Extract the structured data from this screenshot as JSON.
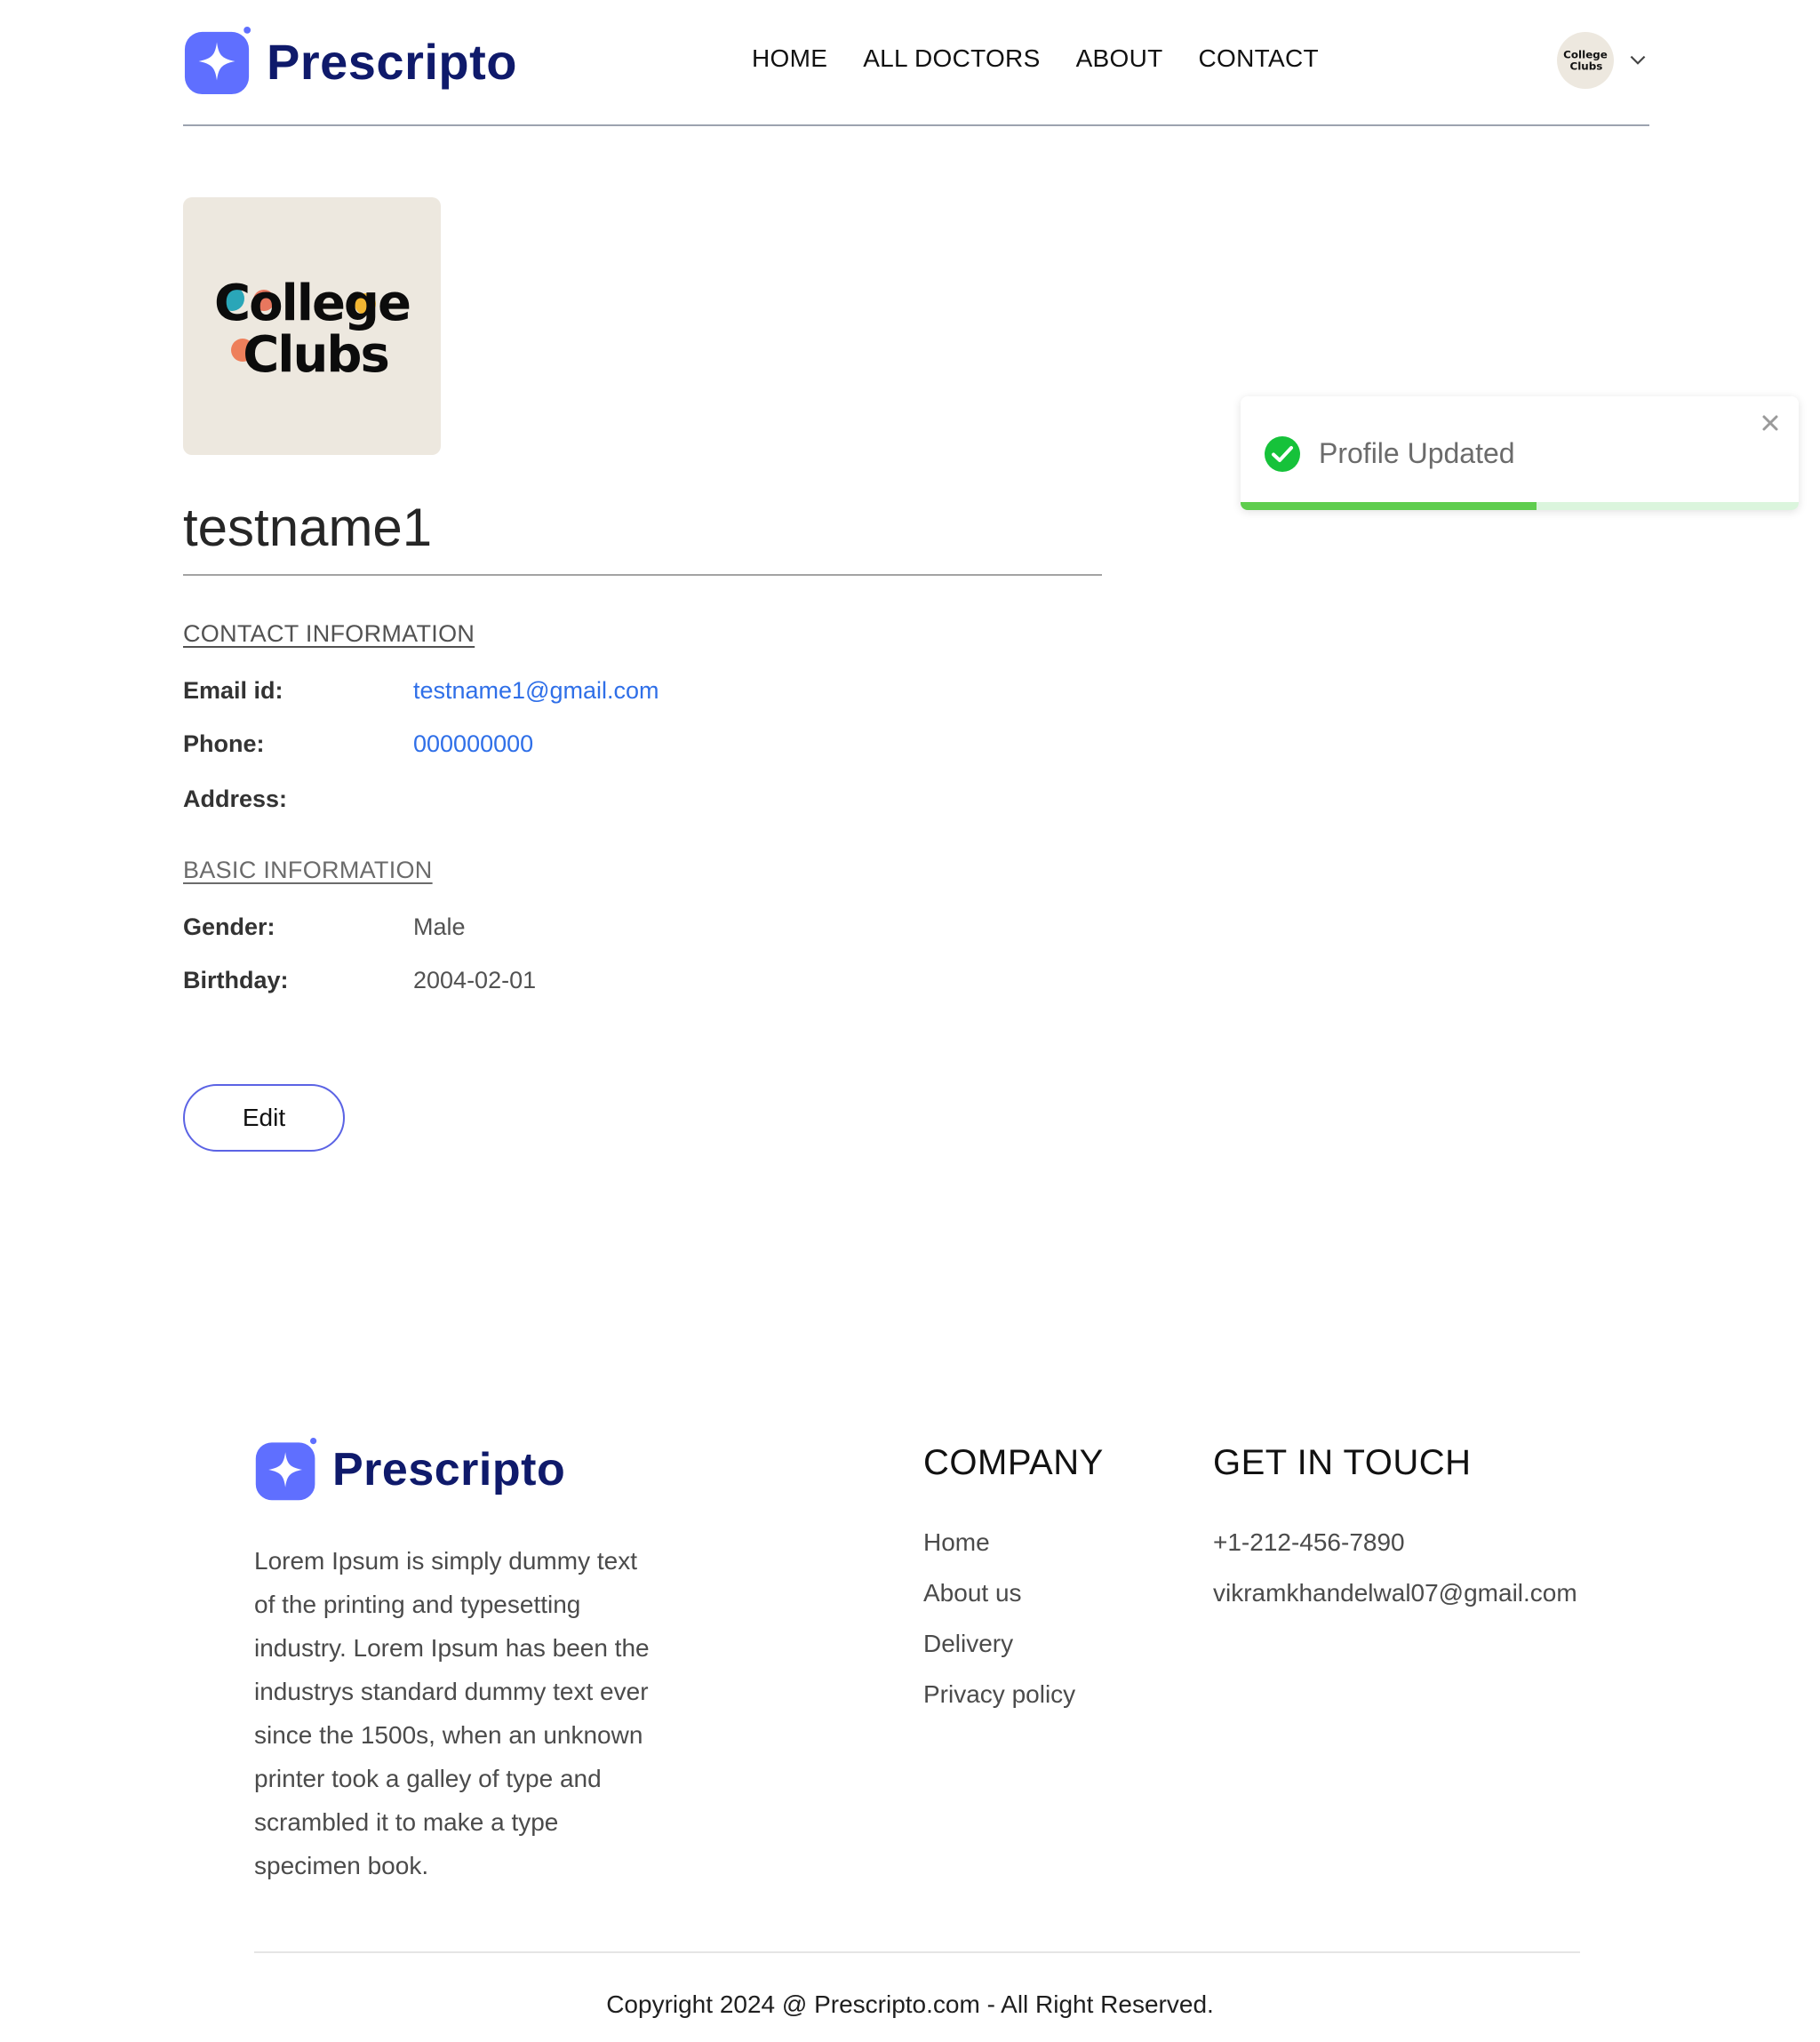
{
  "brand": {
    "name": "Prescripto",
    "color": "#0f1a6b",
    "logo_color": "#5f6fff"
  },
  "nav": {
    "links": [
      "HOME",
      "ALL DOCTORS",
      "ABOUT",
      "CONTACT"
    ],
    "user_avatar_text": [
      "College",
      "Clubs"
    ],
    "dropdown_icon": "chevron-down-icon"
  },
  "profile": {
    "image_text": [
      "College",
      "Clubs"
    ],
    "name": "testname1",
    "contact_title": "CONTACT INFORMATION",
    "email_label": "Email id:",
    "email": "testname1@gmail.com",
    "phone_label": "Phone:",
    "phone": "000000000",
    "address_label": "Address:",
    "address": "",
    "basic_title": "BASIC INFORMATION",
    "gender_label": "Gender:",
    "gender": "Male",
    "birthday_label": "Birthday:",
    "birthday": "2004-02-01",
    "edit_label": "Edit",
    "accent_link_color": "#2f6fe8",
    "button_border_color": "#5b63e4"
  },
  "toast": {
    "message": "Profile Updated",
    "status": "success",
    "icon": "check-circle-icon",
    "progress": 0.53,
    "bar_color": "#5fcd4e"
  },
  "footer": {
    "description": "Lorem Ipsum is simply dummy text of the printing and typesetting industry. Lorem Ipsum has been the industrys standard dummy text ever since the 1500s, when an unknown printer took a galley of type and scrambled it to make a type specimen book.",
    "company_title": "COMPANY",
    "company_links": [
      "Home",
      "About us",
      "Delivery",
      "Privacy policy"
    ],
    "touch_title": "GET IN TOUCH",
    "phone": "+1-212-456-7890",
    "email": "vikramkhandelwal07@gmail.com",
    "copyright": "Copyright 2024 @ Prescripto.com - All Right Reserved."
  }
}
